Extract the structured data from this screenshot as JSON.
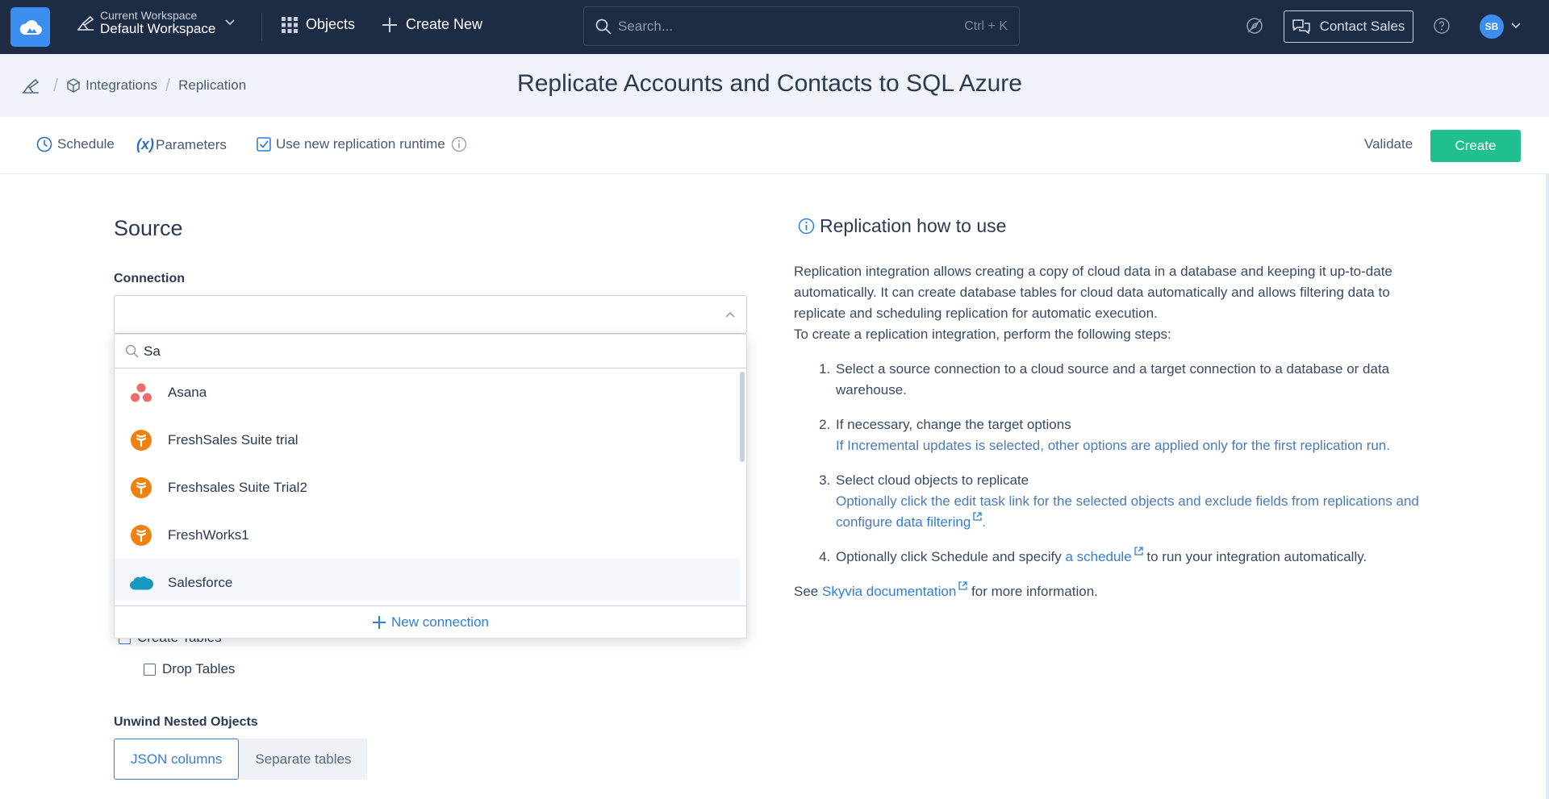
{
  "topbar": {
    "workspace_label": "Current Workspace",
    "workspace_name": "Default Workspace",
    "objects_label": "Objects",
    "create_new_label": "Create New",
    "search_placeholder": "Search...",
    "search_shortcut": "Ctrl + K",
    "contact_sales_label": "Contact Sales",
    "avatar_initials": "SB"
  },
  "breadcrumb": {
    "items": [
      "Integrations",
      "Replication"
    ]
  },
  "page": {
    "title": "Replicate Accounts and Contacts to SQL Azure"
  },
  "toolbar": {
    "schedule_label": "Schedule",
    "parameters_label": "Parameters",
    "runtime_label": "Use new replication runtime",
    "runtime_checked": true,
    "validate_label": "Validate",
    "create_label": "Create"
  },
  "source": {
    "section_title": "Source",
    "connection_label": "Connection",
    "dropdown": {
      "search_value": "Sa",
      "items": [
        {
          "label": "Asana",
          "icon": "asana-icon"
        },
        {
          "label": "FreshSales Suite trial",
          "icon": "freshsales-icon"
        },
        {
          "label": "Freshsales Suite Trial2",
          "icon": "freshsales-icon"
        },
        {
          "label": "FreshWorks1",
          "icon": "freshsales-icon"
        },
        {
          "label": "Salesforce",
          "icon": "salesforce-icon"
        }
      ],
      "highlighted": "Salesforce",
      "new_connection_label": "New connection"
    },
    "create_tables_label": "Create Tables",
    "create_tables_checked": true,
    "drop_tables_label": "Drop Tables",
    "drop_tables_checked": false,
    "unwind_label": "Unwind Nested Objects",
    "unwind_options": [
      "JSON columns",
      "Separate tables"
    ],
    "unwind_selected": "JSON columns"
  },
  "help": {
    "title": "Replication how to use",
    "intro_1": "Replication integration allows creating a copy of cloud data in a database and keeping it up-to-date automatically. It can create database tables for cloud data automatically and allows filtering data to replicate and scheduling replication for automatic execution.",
    "intro_2": "To create a replication integration, perform the following steps:",
    "step1": "Select a source connection to a cloud source and a target connection to a database or data warehouse.",
    "step2": "If necessary, change the target options",
    "step2_note": "If Incremental updates is selected, other options are applied only for the first replication run.",
    "step3": "Select cloud objects to replicate",
    "step3_note_a": "Optionally click the edit task link for the selected objects and exclude fields from replications and configure",
    "step3_link": "data filtering",
    "step3_note_b": ".",
    "step4_a": "Optionally click Schedule and specify",
    "step4_link": "a schedule",
    "step4_b": "to run your integration automatically.",
    "see_a": "See",
    "see_link": "Skyvia documentation",
    "see_b": "for more information."
  },
  "colors": {
    "topbar_bg": "#1d2b45",
    "accent": "#2f7fd8",
    "create_button": "#1fbf8f",
    "header_bg": "#f0f4fa"
  }
}
